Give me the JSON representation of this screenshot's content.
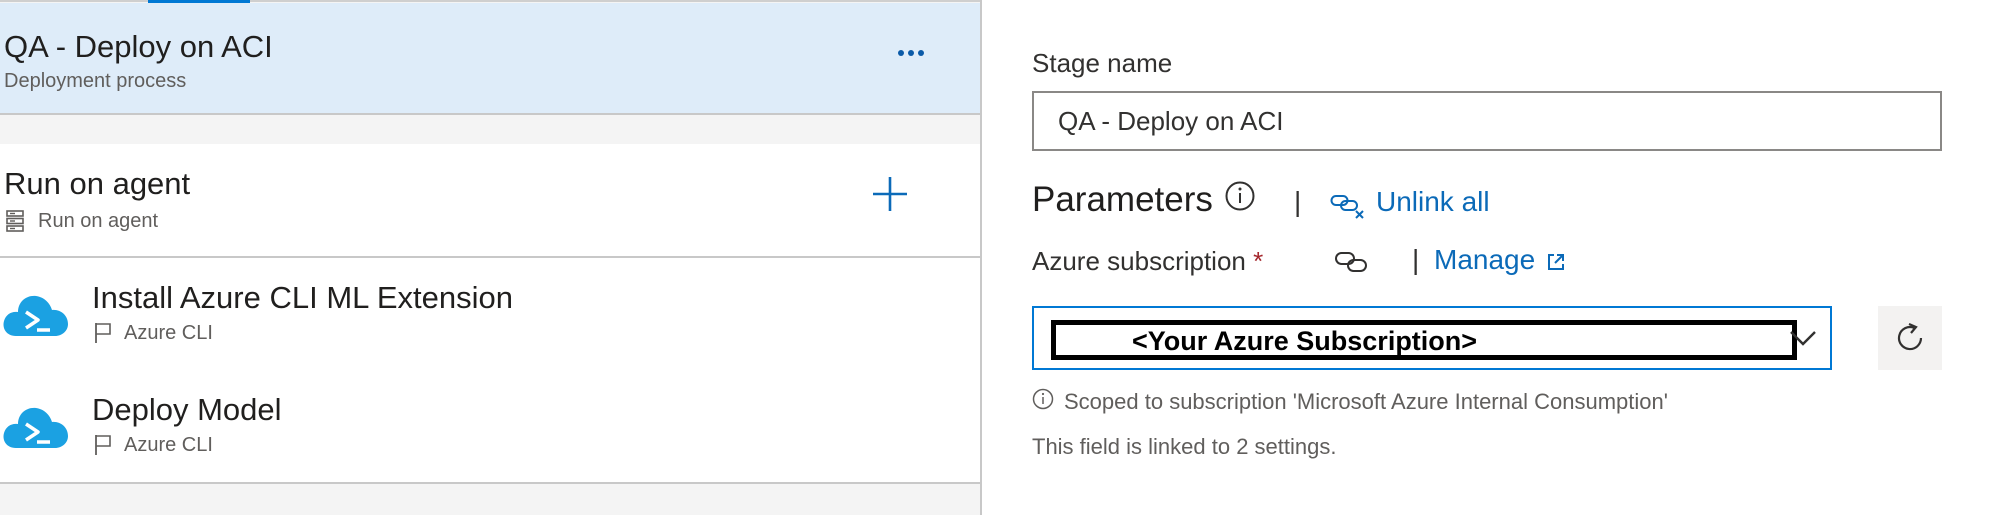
{
  "stage": {
    "title": "QA - Deploy on ACI",
    "subtitle": "Deployment process"
  },
  "agent_job": {
    "title": "Run on agent",
    "subtitle": "Run on agent"
  },
  "tasks": [
    {
      "title": "Install Azure CLI ML Extension",
      "subtitle": "Azure CLI",
      "icon": "azure-cli-cloud-icon"
    },
    {
      "title": "Deploy Model",
      "subtitle": "Azure CLI",
      "icon": "azure-cli-cloud-icon"
    }
  ],
  "form": {
    "stage_name_label": "Stage name",
    "stage_name_value": "QA - Deploy on ACI",
    "parameters_title": "Parameters",
    "separator": "|",
    "unlink_all": "Unlink all",
    "azure_subscription_label": "Azure subscription",
    "required_marker": "*",
    "manage": "Manage",
    "subscription_value": "<Your Azure Subscription>",
    "scope_text": "Scoped to subscription 'Microsoft Azure Internal Consumption'",
    "linked_text": "This field is linked to 2 settings."
  },
  "colors": {
    "accent": "#0078d4",
    "link": "#0b6ab8",
    "selected_bg": "#deecf9",
    "azure_cli_icon": "#1ba1e2",
    "required": "#a4262c"
  }
}
